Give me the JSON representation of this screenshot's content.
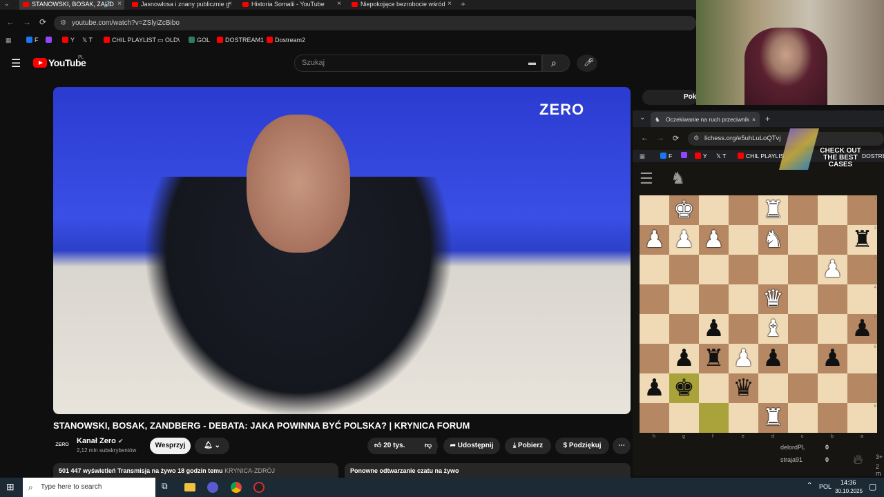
{
  "browser": {
    "tabs": [
      {
        "title": "STANOWSKI, BOSAK, ZAND",
        "active": true
      },
      {
        "title": "Jasnowłosa i znany publicznie g",
        "active": false
      },
      {
        "title": "Historia Somalii - YouTube",
        "active": false
      },
      {
        "title": "Niepokojące bezrobocie wśród",
        "active": false
      }
    ],
    "url": "youtube.com/watch?v=ZSlyiZcBibo",
    "bookmarks": [
      "F",
      "Y",
      "T",
      "CHIL PLAYLIST",
      "OLD\\",
      "GOL",
      "DOSTREAM1",
      "Dostream2"
    ]
  },
  "youtube": {
    "logo": "YouTube",
    "region": "PL",
    "search_placeholder": "Szukaj",
    "video_brand": "ZERO",
    "title": "STANOWSKI, BOSAK, ZANDBERG - DEBATA: JAKA POWINNA BYĆ POLSKA? | KRYNICA FORUM",
    "channel_avatar": "ZERO",
    "channel": "Kanał Zero",
    "subs": "2,12 mln subskrybentów",
    "support": "Wesprzyj",
    "likes": "20 tys.",
    "share": "Udostępnij",
    "download": "Pobierz",
    "thanks": "Podziękuj",
    "views": "501 447 wyświetleń  Transmisja na żywo 18 godzin temu",
    "location": "KRYNICA-ZDRÓJ",
    "chat_replay": "Ponowne odtwarzanie czatu na żywo",
    "overlay_btn": "Pok"
  },
  "lichess": {
    "tab": "Oczekiwanie na ruch przeciwnik",
    "url": "lichess.org/e5uhLuLoQTvj",
    "bookmarks": [
      "F",
      "Y",
      "T",
      "CHIL PLAYLIS",
      "DOSTREA"
    ],
    "ad": "CHECK OUT THE BEST CASES",
    "files": [
      "h",
      "g",
      "f",
      "e",
      "d",
      "c",
      "b",
      "a"
    ],
    "ranks": [
      "1",
      "2",
      "3",
      "4",
      "5",
      "6",
      "7",
      "8"
    ],
    "pieces": [
      {
        "c": 1,
        "r": 0,
        "g": "♚",
        "w": true
      },
      {
        "c": 4,
        "r": 0,
        "g": "♜",
        "w": true
      },
      {
        "c": 0,
        "r": 1,
        "g": "♟",
        "w": true
      },
      {
        "c": 1,
        "r": 1,
        "g": "♟",
        "w": true
      },
      {
        "c": 2,
        "r": 1,
        "g": "♟",
        "w": true
      },
      {
        "c": 4,
        "r": 1,
        "g": "♞",
        "w": true
      },
      {
        "c": 7,
        "r": 1,
        "g": "♜",
        "w": false
      },
      {
        "c": 6,
        "r": 2,
        "g": "♟",
        "w": true
      },
      {
        "c": 4,
        "r": 3,
        "g": "♛",
        "w": true
      },
      {
        "c": 2,
        "r": 4,
        "g": "♟",
        "w": false
      },
      {
        "c": 4,
        "r": 4,
        "g": "♝",
        "w": true
      },
      {
        "c": 7,
        "r": 4,
        "g": "♟",
        "w": false
      },
      {
        "c": 1,
        "r": 5,
        "g": "♟",
        "w": false
      },
      {
        "c": 2,
        "r": 5,
        "g": "♜",
        "w": false
      },
      {
        "c": 3,
        "r": 5,
        "g": "♟",
        "w": true
      },
      {
        "c": 4,
        "r": 5,
        "g": "♟",
        "w": false
      },
      {
        "c": 6,
        "r": 5,
        "g": "♟",
        "w": false
      },
      {
        "c": 0,
        "r": 6,
        "g": "♟",
        "w": false
      },
      {
        "c": 1,
        "r": 6,
        "g": "♚",
        "w": false
      },
      {
        "c": 3,
        "r": 6,
        "g": "♛",
        "w": false
      },
      {
        "c": 4,
        "r": 7,
        "g": "♜",
        "w": true
      }
    ],
    "highlights": [
      {
        "c": 1,
        "r": 6
      },
      {
        "c": 2,
        "r": 7
      }
    ],
    "players": [
      {
        "name": "delordPL",
        "score": "0"
      },
      {
        "name": "straja91",
        "score": "0"
      }
    ],
    "side_text": [
      "3+",
      "2 m"
    ]
  },
  "taskbar": {
    "search": "Type here to search",
    "lang": "POL",
    "time": "14:36",
    "date": "30.10.2025"
  }
}
